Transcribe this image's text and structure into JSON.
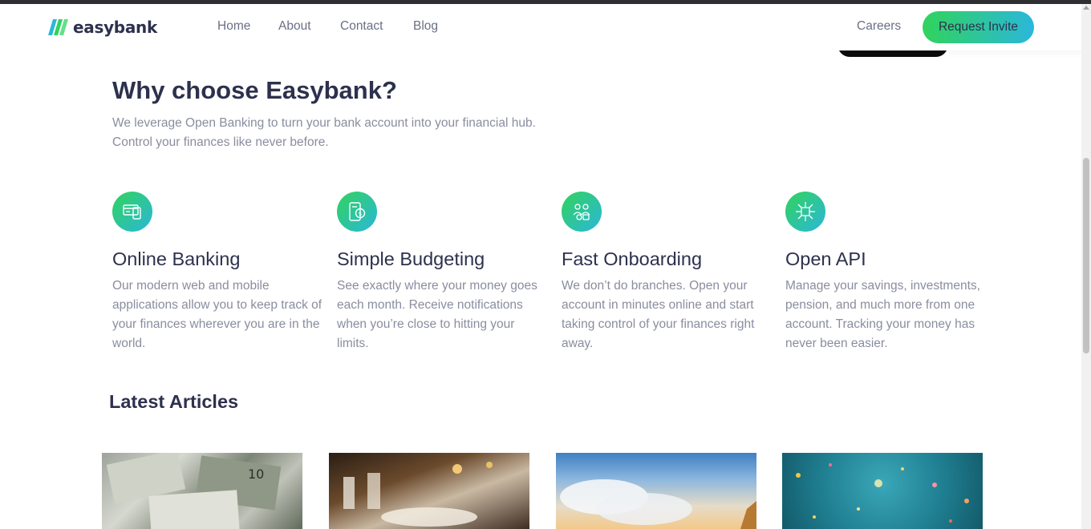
{
  "nav": {
    "brand": "easybank",
    "links": [
      "Home",
      "About",
      "Contact",
      "Blog"
    ],
    "careers": "Careers",
    "cta": "Request Invite"
  },
  "why": {
    "title": "Why choose Easybank?",
    "subtitle_line1": "We leverage Open Banking to turn your bank account into your financial hub.",
    "subtitle_line2": "Control your finances like never before."
  },
  "features": [
    {
      "icon": "online-banking-icon",
      "title": "Online Banking",
      "desc": "Our modern web and mobile applications allow you to keep track of your finances wherever you are in the world."
    },
    {
      "icon": "budgeting-icon",
      "title": "Simple Budgeting",
      "desc": "See exactly where your money goes each month. Receive notifications when you’re close to hitting your limits."
    },
    {
      "icon": "onboarding-icon",
      "title": "Fast Onboarding",
      "desc": "We don’t do branches. Open your account in minutes online and start taking control of your finances right away."
    },
    {
      "icon": "api-icon",
      "title": "Open API",
      "desc": "Manage your savings, investments, pension, and much more from one account. Tracking your money has never been easier."
    }
  ],
  "articles": {
    "title": "Latest Articles",
    "images": [
      "money-image",
      "restaurant-image",
      "plane-sky-image",
      "confetti-image"
    ]
  },
  "colors": {
    "text_dark": "#2d314d",
    "text_grey": "#8a8d9f",
    "gradient_start": "#31d35c",
    "gradient_end": "#2bb7da"
  }
}
